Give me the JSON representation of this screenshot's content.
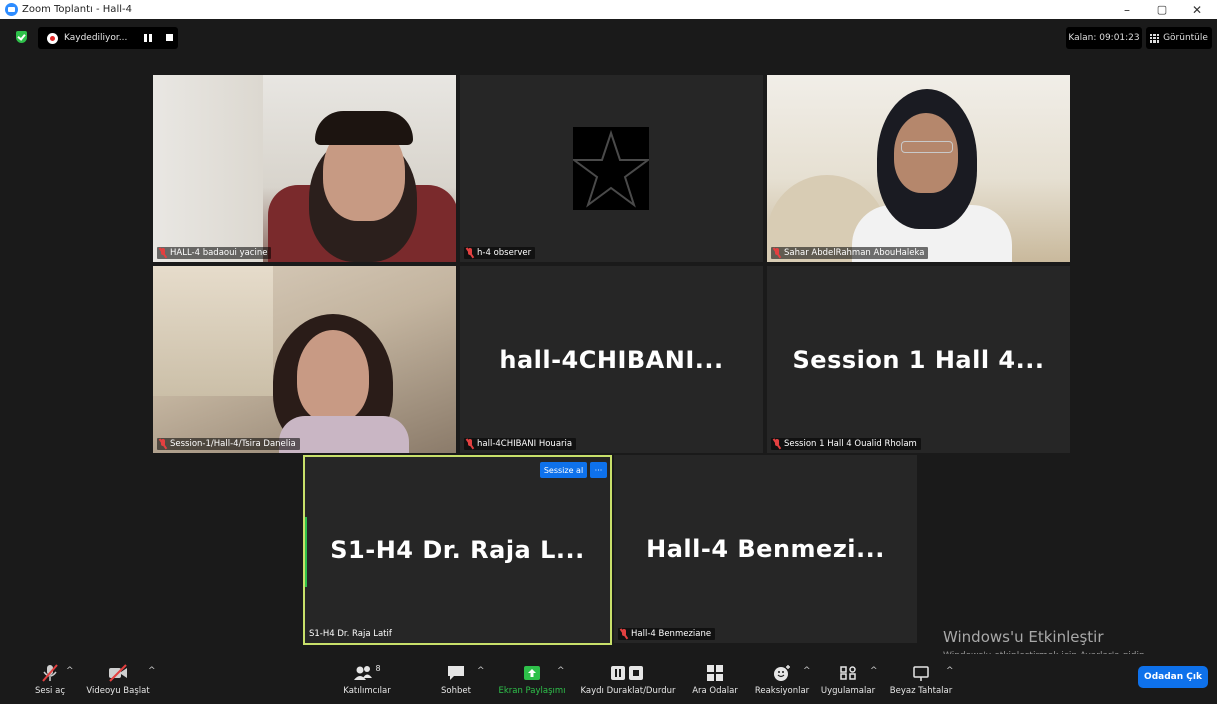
{
  "window": {
    "title": "Zoom Toplantı - Hall-4",
    "controls": [
      "–",
      "▢",
      "✕"
    ]
  },
  "topbar": {
    "recording_label": "Kaydediliyor...",
    "timer_label": "Kalan: 09:01:23",
    "view_label": "Görüntüle"
  },
  "tiles": [
    {
      "name": "HALL-4 badaoui yacine",
      "type": "video"
    },
    {
      "name": "h-4 observer",
      "type": "avatar"
    },
    {
      "name": "Sahar AbdelRahman AbouHaleka",
      "type": "video"
    },
    {
      "name": "Session-1/Hall-4/Tsira Danelia",
      "type": "video"
    },
    {
      "name": "hall-4CHIBANI Houaria",
      "display": "hall-4CHIBANI...",
      "type": "name"
    },
    {
      "name": "Session 1 Hall 4 Oualid Rholam",
      "display": "Session 1 Hall 4...",
      "type": "name"
    },
    {
      "name": "S1-H4 Dr. Raja Latif",
      "display": "S1-H4 Dr. Raja L...",
      "type": "name",
      "active": true
    },
    {
      "name": "Hall-4 Benmeziane",
      "display": "Hall-4 Benmezi...",
      "type": "name"
    }
  ],
  "active_tile": {
    "mute_button": "Sessize al",
    "more_button": "···"
  },
  "toolbar": {
    "unmute": "Sesi aç",
    "start_video": "Videoyu Başlat",
    "participants": "Katılımcılar",
    "participants_count": "8",
    "chat": "Sohbet",
    "share_screen": "Ekran Paylaşımı",
    "pause_recording": "Kaydı Duraklat/Durdur",
    "breakout": "Ara Odalar",
    "reactions": "Reaksiyonlar",
    "apps": "Uygulamalar",
    "whiteboard": "Beyaz Tahtalar",
    "leave": "Odadan Çık"
  },
  "watermark": {
    "line1": "Windows'u Etkinleştir",
    "line2": "Windows'u etkinleştirmek için Ayarlar'a gidin."
  },
  "colors": {
    "accent": "#0e71eb",
    "active_border": "#c8e06a",
    "share_green": "#2ec04a",
    "mute_red": "#e34040"
  }
}
